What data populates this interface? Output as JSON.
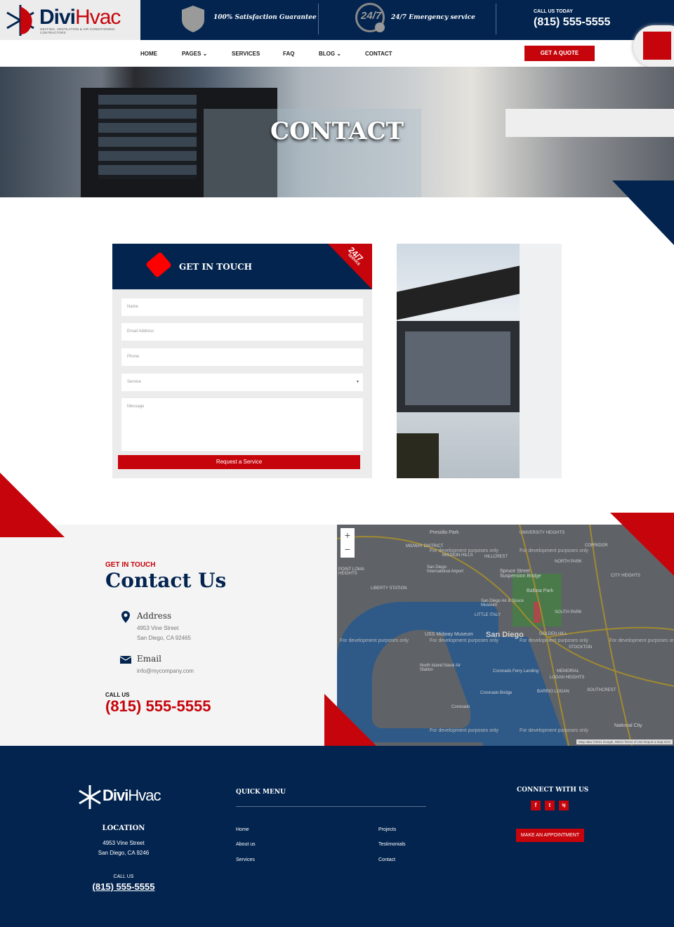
{
  "header": {
    "logo_main": "Divi",
    "logo_accent": "Hvac",
    "logo_tagline": "HEATING, VENTILATION & AIR CONDITIONING CONTRACTORS",
    "feature1": "100% Satisfaction Guarantee",
    "feature2": "24/7 Emergency service",
    "badge_247": "24/7",
    "call_label": "CALL US TODAY",
    "phone": "(815) 555-5555"
  },
  "nav": {
    "items": [
      "HOME",
      "PAGES",
      "SERVICES",
      "FAQ",
      "BLOG",
      "CONTACT"
    ],
    "quote_button": "GET A QUOTE"
  },
  "hero": {
    "title": "CONTACT"
  },
  "form": {
    "title": "GET IN TOUCH",
    "ribbon_big": "24/7",
    "ribbon_small": "SERVICE",
    "name_placeholder": "Name",
    "email_placeholder": "Email Address",
    "phone_placeholder": "Phone",
    "service_placeholder": "Service",
    "message_placeholder": "Message",
    "submit": "Request a Service"
  },
  "contact": {
    "eyebrow": "GET IN TOUCH",
    "title": "Contact Us",
    "address_label": "Address",
    "address_line1": "4953 Vine Street",
    "address_line2": "San Diego, CA 92465",
    "email_label": "Email",
    "email": "info@mycompany.com",
    "call_label": "CALL US",
    "phone": "(815) 555-5555"
  },
  "map": {
    "zoom_in": "+",
    "zoom_out": "−",
    "watermark": "For development purposes only",
    "labels": [
      "Presidio Park",
      "UNIVERSITY HEIGHTS",
      "MIDWAY DISTRICT",
      "MISSION HILLS",
      "HILLCREST",
      "NORTH PARK",
      "CORRIDOR",
      "San Diego International Airport",
      "Spruce Street Suspension Bridge",
      "POINT LOMA HEIGHTS",
      "LIBERTY STATION",
      "Balboa Park",
      "CITY HEIGHTS",
      "San Diego Air & Space Museum",
      "LITTLE ITALY",
      "SOUTH PARK",
      "USS Midway Museum",
      "San Diego",
      "GOLDEN HILL",
      "STOCKTON",
      "North Island Naval Air Station",
      "Coronado Ferry Landing",
      "MEMORIAL",
      "LOGAN HEIGHTS",
      "Coronado Bridge",
      "BARRIO LOGAN",
      "SOUTHCREST",
      "Coronado",
      "National City"
    ],
    "attribution": "Map data ©2021 Google, INEGI  Terms of Use  Report a map error"
  },
  "footer": {
    "logo_main": "Divi",
    "logo_accent": "Hvac",
    "location_title": "LOCATION",
    "address_line1": "4953 Vine Street",
    "address_line2": "San Diego, CA 9246",
    "call_label": "CALL US",
    "phone": "(815) 555-5555",
    "quick_menu_title": "QUICK MENU",
    "links": [
      "Home",
      "About us",
      "Services",
      "Projects",
      "Testimonials",
      "Contact"
    ],
    "connect_title": "CONNECT WITH US",
    "social": [
      "f",
      "t",
      "ig"
    ],
    "appointment": "MAKE AN APPOINTMENT"
  },
  "colors": {
    "navy": "#02244f",
    "red": "#c6040b",
    "light": "#f4f4f4"
  }
}
